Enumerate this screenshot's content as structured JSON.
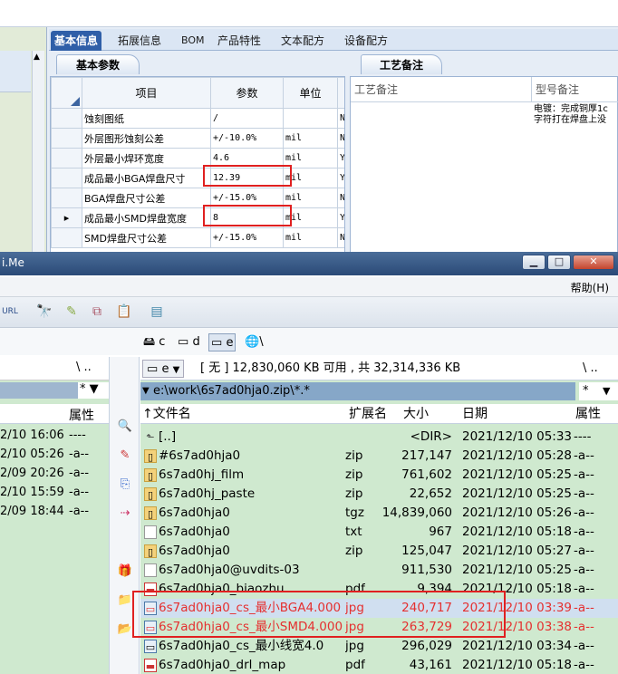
{
  "top_app": {
    "tabs": [
      "基本信息",
      "拓展信息",
      "BOM",
      "产品特性",
      "文本配方",
      "设备配方"
    ],
    "active_tab": "基本信息",
    "subtab_left": "基本参数",
    "subtab_right": "工艺备注",
    "grid_headers": [
      "项目",
      "参数",
      "单位"
    ],
    "rows": [
      {
        "item": "蚀刻图纸",
        "value": "/",
        "unit": "",
        "flag": "N"
      },
      {
        "item": "外层图形蚀刻公差",
        "value": "+/-10.0%",
        "unit": "mil",
        "flag": "N"
      },
      {
        "item": "外层最小焊环宽度",
        "value": "4.6",
        "unit": "mil",
        "flag": "Y"
      },
      {
        "item": "成品最小BGA焊盘尺寸",
        "value": "12.39",
        "unit": "mil",
        "flag": "Y"
      },
      {
        "item": "BGA焊盘尺寸公差",
        "value": "+/-15.0%",
        "unit": "mil",
        "flag": "N"
      },
      {
        "item": "成品最小SMD焊盘宽度",
        "value": "8",
        "unit": "mil",
        "flag": "Y"
      },
      {
        "item": "SMD焊盘尺寸公差",
        "value": "+/-15.0%",
        "unit": "mil",
        "flag": "N"
      }
    ],
    "current_row_marker": "▸",
    "notes_headers": [
      "工艺备注",
      "型号备注"
    ],
    "model_note": "电镀：完成铜厚1c 字符打在焊盘上没"
  },
  "file_manager": {
    "title": "i.Me",
    "help_menu": "帮助(H)",
    "drives": [
      "c",
      "d",
      "e",
      "\\"
    ],
    "selected_drive": "e",
    "left_path": "\\  ..",
    "left_filter": "*",
    "left_header_attr": "属性",
    "left_rows": [
      {
        "date": "2/10 16:06",
        "attr": "----"
      },
      {
        "date": "2/10 05:26",
        "attr": "-a--"
      },
      {
        "date": "2/09 20:26",
        "attr": "-a--"
      },
      {
        "date": "2/10 15:59",
        "attr": "-a--"
      },
      {
        "date": "2/09 18:44",
        "attr": "-a--"
      }
    ],
    "right_drive": "e",
    "right_drive_info": "[ 无 ]  12,830,060 KB 可用 , 共 32,314,336 KB",
    "right_nav": "\\  ..",
    "right_path": "e:\\work\\6s7ad0hja0.zip\\*.*",
    "right_filter": "*",
    "columns": {
      "name": "↑文件名",
      "ext": "扩展名",
      "size": "大小",
      "date": "日期",
      "attr": "属性"
    },
    "files": [
      {
        "name": "[..]",
        "ext": "",
        "size": "<DIR>",
        "date": "2021/12/10 05:33",
        "attr": "----",
        "icon": "up-icon"
      },
      {
        "name": "#6s7ad0hja0",
        "ext": "zip",
        "size": "217,147",
        "date": "2021/12/10 05:28",
        "attr": "-a--",
        "icon": "zip-icon"
      },
      {
        "name": "6s7ad0hj_film",
        "ext": "zip",
        "size": "761,602",
        "date": "2021/12/10 05:25",
        "attr": "-a--",
        "icon": "zip-icon"
      },
      {
        "name": "6s7ad0hj_paste",
        "ext": "zip",
        "size": "22,652",
        "date": "2021/12/10 05:25",
        "attr": "-a--",
        "icon": "zip-icon"
      },
      {
        "name": "6s7ad0hja0",
        "ext": "tgz",
        "size": "14,839,060",
        "date": "2021/12/10 05:26",
        "attr": "-a--",
        "icon": "zip-icon"
      },
      {
        "name": "6s7ad0hja0",
        "ext": "txt",
        "size": "967",
        "date": "2021/12/10 05:18",
        "attr": "-a--",
        "icon": "doc-icon"
      },
      {
        "name": "6s7ad0hja0",
        "ext": "zip",
        "size": "125,047",
        "date": "2021/12/10 05:27",
        "attr": "-a--",
        "icon": "zip-icon"
      },
      {
        "name": "6s7ad0hja0@uvdits-03",
        "ext": "",
        "size": "911,530",
        "date": "2021/12/10 05:25",
        "attr": "-a--",
        "icon": "doc-icon"
      },
      {
        "name": "6s7ad0hja0_biaozhu",
        "ext": "pdf",
        "size": "9,394",
        "date": "2021/12/10 05:18",
        "attr": "-a--",
        "icon": "pdf-icon"
      },
      {
        "name": "6s7ad0hja0_cs_最小BGA4.000",
        "ext": "jpg",
        "size": "240,717",
        "date": "2021/12/10 03:39",
        "attr": "-a--",
        "icon": "image-icon"
      },
      {
        "name": "6s7ad0hja0_cs_最小SMD4.000",
        "ext": "jpg",
        "size": "263,729",
        "date": "2021/12/10 03:38",
        "attr": "-a--",
        "icon": "image-icon"
      },
      {
        "name": "6s7ad0hja0_cs_最小线宽4.0",
        "ext": "jpg",
        "size": "296,029",
        "date": "2021/12/10 03:34",
        "attr": "-a--",
        "icon": "image-icon"
      },
      {
        "name": "6s7ad0hja0_drl_map",
        "ext": "pdf",
        "size": "43,161",
        "date": "2021/12/10 05:18",
        "attr": "-a--",
        "icon": "pdf-icon"
      }
    ],
    "highlight_color": "#e02020"
  }
}
